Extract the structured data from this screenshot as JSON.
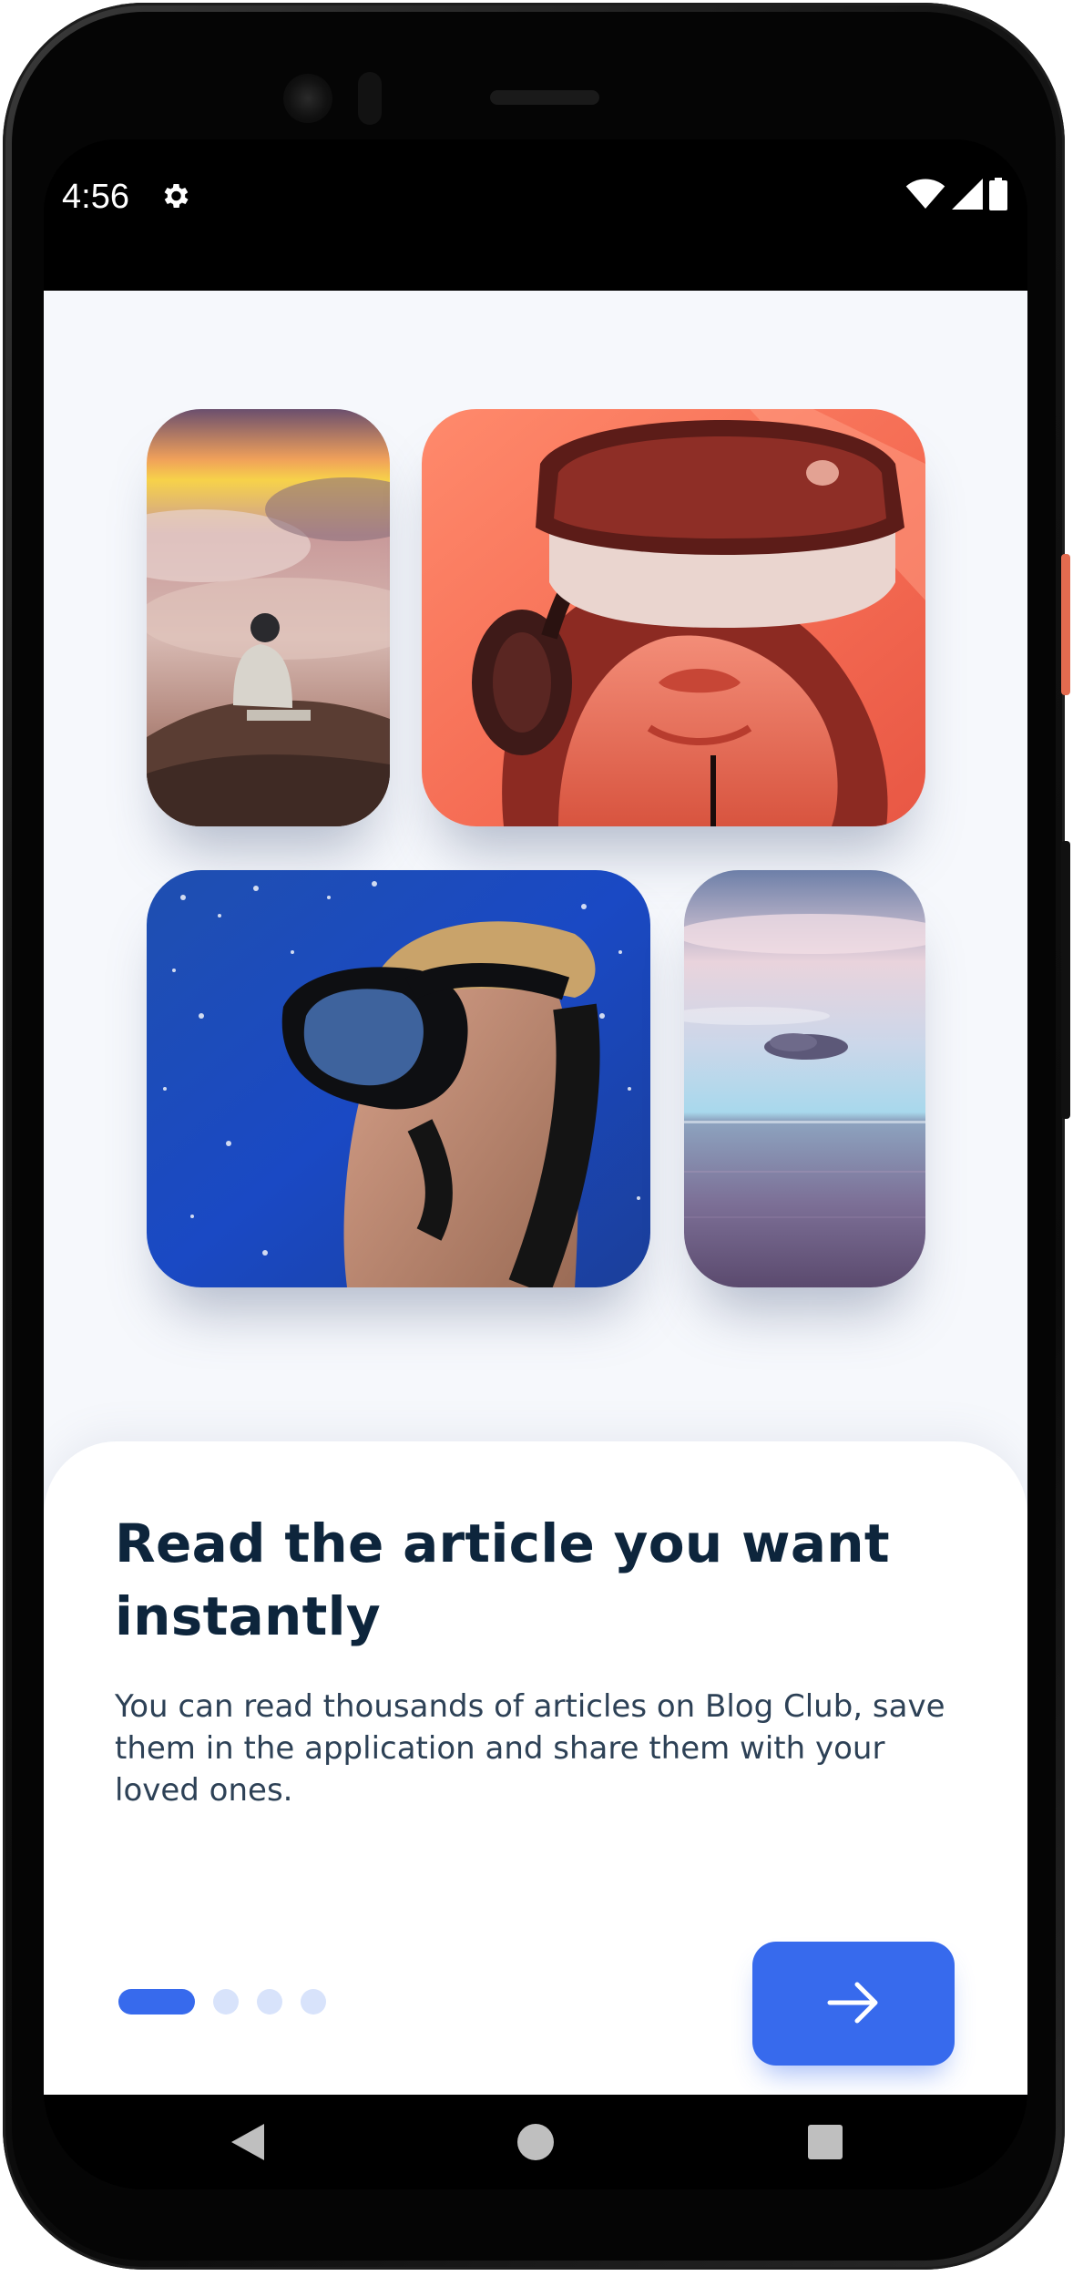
{
  "status_bar": {
    "time": "4:56",
    "icons": [
      "gear-icon",
      "wifi-icon",
      "signal-icon",
      "battery-icon"
    ]
  },
  "gallery": {
    "images": [
      {
        "name": "mountain-meditation-image",
        "subject": "person sitting on a rock above the clouds"
      },
      {
        "name": "vr-headset-image",
        "subject": "person wearing a VR headset"
      },
      {
        "name": "scuba-diver-image",
        "subject": "diver with mask and snorkel underwater"
      },
      {
        "name": "ocean-horizon-image",
        "subject": "calm sea under a pastel sky"
      }
    ]
  },
  "onboarding": {
    "title": "Read the article you want instantly",
    "description": "You can read thousands of articles on Blog Club, save them in the application and share them with your loved ones.",
    "page_indicator": {
      "total": 4,
      "current": 1
    },
    "next_button_icon": "arrow-right-icon"
  },
  "nav_bar": {
    "icons": [
      "back-icon",
      "home-icon",
      "recents-icon"
    ]
  },
  "colors": {
    "primary": "#376aed",
    "title": "#0d253c",
    "body": "#2d4156",
    "background": "#f6f8fc",
    "indicator_inactive": "#d8e3fb"
  }
}
